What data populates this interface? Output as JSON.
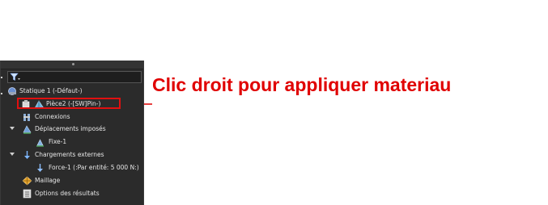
{
  "annotation": {
    "text": "Clic droit pour appliquer materiau",
    "color": "#e00000"
  },
  "tree": {
    "root_label": "Statique 1 (-Défaut-)",
    "part_label": "Pièce2 (-[SW]Pin-)",
    "connections_label": "Connexions",
    "fixtures_label": "Déplacements imposés",
    "fixture_item_label": "Fixe-1",
    "loads_label": "Chargements externes",
    "load_item_label": "Force-1 (:Par entité: 5 000 N:)",
    "mesh_label": "Maillage",
    "results_options_label": "Options des résultats"
  },
  "icons": {
    "filter": "filter-icon",
    "study": "static-study-icon",
    "part": "part-icon",
    "connections": "connections-icon",
    "fixtures": "fixtures-icon",
    "fixture_item": "fixed-geometry-icon",
    "loads": "external-loads-icon",
    "load_item": "force-arrow-icon",
    "mesh": "mesh-icon",
    "results_options": "results-options-icon"
  },
  "colors": {
    "panel_bg": "#2b2b2b",
    "text": "#e6e6e6",
    "highlight": "#e01010"
  }
}
